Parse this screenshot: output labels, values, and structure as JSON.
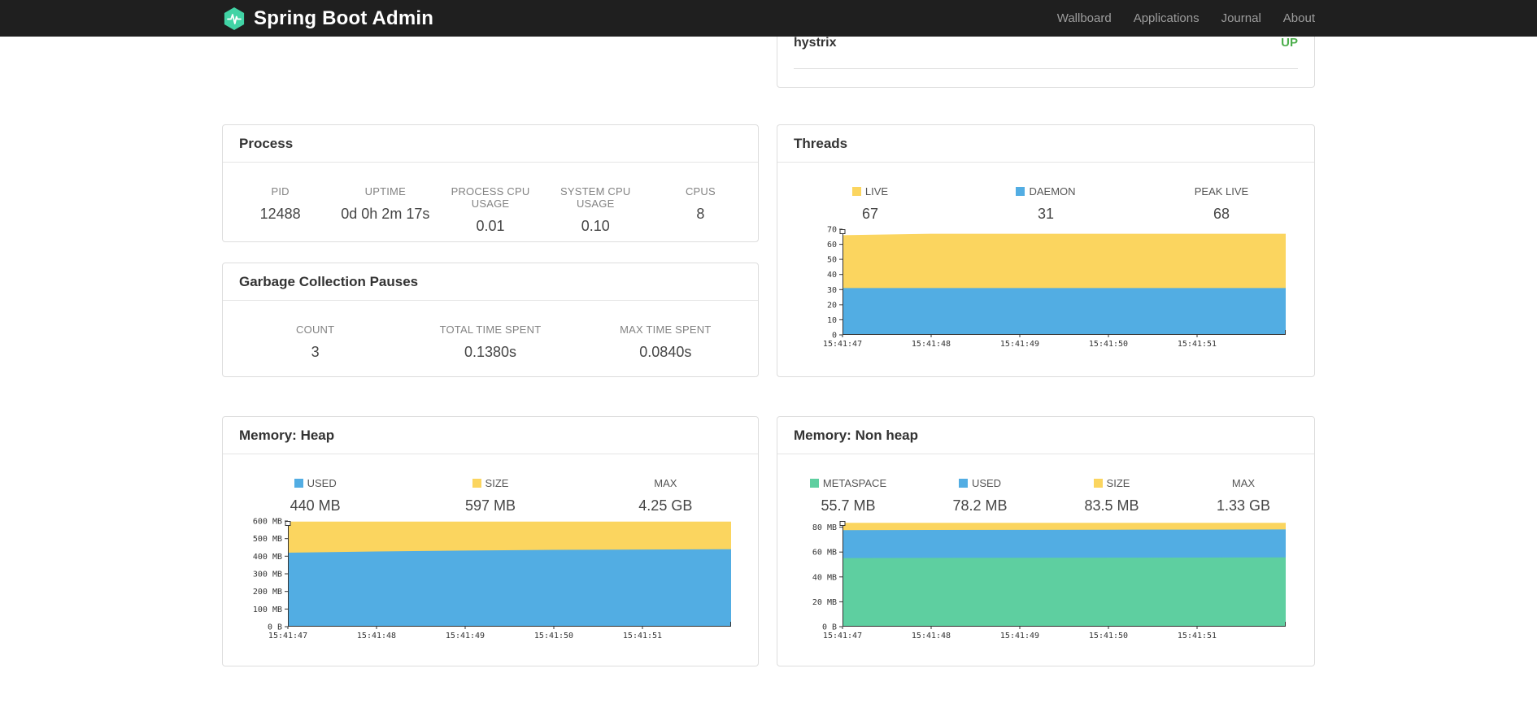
{
  "navbar": {
    "brand": "Spring Boot Admin",
    "items": [
      "Wallboard",
      "Applications",
      "Journal",
      "About"
    ]
  },
  "colors": {
    "accent_teal": "#41d3a5",
    "blue": "#52ade3",
    "yellow": "#fbd55f",
    "green": "#5ecfa0",
    "status_up": "#4cae4c"
  },
  "application_row": {
    "name": "hystrix",
    "status": "UP"
  },
  "cards": {
    "process": {
      "title": "Process",
      "metrics": [
        {
          "label": "PID",
          "value": "12488"
        },
        {
          "label": "UPTIME",
          "value": "0d 0h 2m 17s"
        },
        {
          "label": "PROCESS CPU USAGE",
          "value": "0.01"
        },
        {
          "label": "SYSTEM CPU USAGE",
          "value": "0.10"
        },
        {
          "label": "CPUS",
          "value": "8"
        }
      ]
    },
    "gc": {
      "title": "Garbage Collection Pauses",
      "metrics": [
        {
          "label": "COUNT",
          "value": "3"
        },
        {
          "label": "TOTAL TIME SPENT",
          "value": "0.1380s"
        },
        {
          "label": "MAX TIME SPENT",
          "value": "0.0840s"
        }
      ]
    },
    "threads": {
      "title": "Threads",
      "legend": [
        {
          "label": "LIVE",
          "value": "67",
          "color": "#fbd55f"
        },
        {
          "label": "DAEMON",
          "value": "31",
          "color": "#52ade3"
        },
        {
          "label": "PEAK LIVE",
          "value": "68",
          "color": ""
        }
      ]
    },
    "heap": {
      "title": "Memory: Heap",
      "legend": [
        {
          "label": "USED",
          "value": "440 MB",
          "color": "#52ade3"
        },
        {
          "label": "SIZE",
          "value": "597 MB",
          "color": "#fbd55f"
        },
        {
          "label": "MAX",
          "value": "4.25 GB",
          "color": ""
        }
      ]
    },
    "nonheap": {
      "title": "Memory: Non heap",
      "legend": [
        {
          "label": "METASPACE",
          "value": "55.7 MB",
          "color": "#5ecfa0"
        },
        {
          "label": "USED",
          "value": "78.2 MB",
          "color": "#52ade3"
        },
        {
          "label": "SIZE",
          "value": "83.5 MB",
          "color": "#fbd55f"
        },
        {
          "label": "MAX",
          "value": "1.33 GB",
          "color": ""
        }
      ]
    }
  },
  "chart_data": [
    {
      "id": "threads",
      "type": "area",
      "title": "Threads",
      "x": [
        "15:41:47",
        "15:41:48",
        "15:41:49",
        "15:41:50",
        "15:41:51"
      ],
      "ymax": 70,
      "yticks": [
        {
          "v": 0,
          "label": "0"
        },
        {
          "v": 10,
          "label": "10"
        },
        {
          "v": 20,
          "label": "20"
        },
        {
          "v": 30,
          "label": "30"
        },
        {
          "v": 40,
          "label": "40"
        },
        {
          "v": 50,
          "label": "50"
        },
        {
          "v": 60,
          "label": "60"
        },
        {
          "v": 70,
          "label": "70"
        }
      ],
      "series": [
        {
          "name": "LIVE",
          "color": "#fbd55f",
          "values": [
            66,
            67,
            67,
            67,
            67,
            67
          ]
        },
        {
          "name": "DAEMON",
          "color": "#52ade3",
          "values": [
            31,
            31,
            31,
            31,
            31,
            31
          ]
        }
      ]
    },
    {
      "id": "heap",
      "type": "area",
      "title": "Memory: Heap",
      "x": [
        "15:41:47",
        "15:41:48",
        "15:41:49",
        "15:41:50",
        "15:41:51"
      ],
      "ymax": 600,
      "yticks": [
        {
          "v": 0,
          "label": "0 B"
        },
        {
          "v": 100,
          "label": "100 MB"
        },
        {
          "v": 200,
          "label": "200 MB"
        },
        {
          "v": 300,
          "label": "300 MB"
        },
        {
          "v": 400,
          "label": "400 MB"
        },
        {
          "v": 500,
          "label": "500 MB"
        },
        {
          "v": 600,
          "label": "600 MB"
        }
      ],
      "series": [
        {
          "name": "SIZE",
          "color": "#fbd55f",
          "values": [
            597,
            597,
            597,
            597,
            597,
            597
          ]
        },
        {
          "name": "USED",
          "color": "#52ade3",
          "values": [
            420,
            427,
            432,
            436,
            438,
            440
          ]
        }
      ]
    },
    {
      "id": "nonheap",
      "type": "area",
      "title": "Memory: Non heap",
      "x": [
        "15:41:47",
        "15:41:48",
        "15:41:49",
        "15:41:50",
        "15:41:51"
      ],
      "ymax": 85,
      "yticks": [
        {
          "v": 0,
          "label": "0 B"
        },
        {
          "v": 20,
          "label": "20 MB"
        },
        {
          "v": 40,
          "label": "40 MB"
        },
        {
          "v": 60,
          "label": "60 MB"
        },
        {
          "v": 80,
          "label": "80 MB"
        }
      ],
      "series": [
        {
          "name": "SIZE",
          "color": "#fbd55f",
          "values": [
            83.5,
            83.5,
            83.5,
            83.5,
            83.5,
            83.5
          ]
        },
        {
          "name": "USED",
          "color": "#52ade3",
          "values": [
            77.6,
            77.8,
            77.9,
            78,
            78.1,
            78.2
          ]
        },
        {
          "name": "METASPACE",
          "color": "#5ecfa0",
          "values": [
            55.2,
            55.3,
            55.4,
            55.5,
            55.6,
            55.7
          ]
        }
      ]
    }
  ]
}
